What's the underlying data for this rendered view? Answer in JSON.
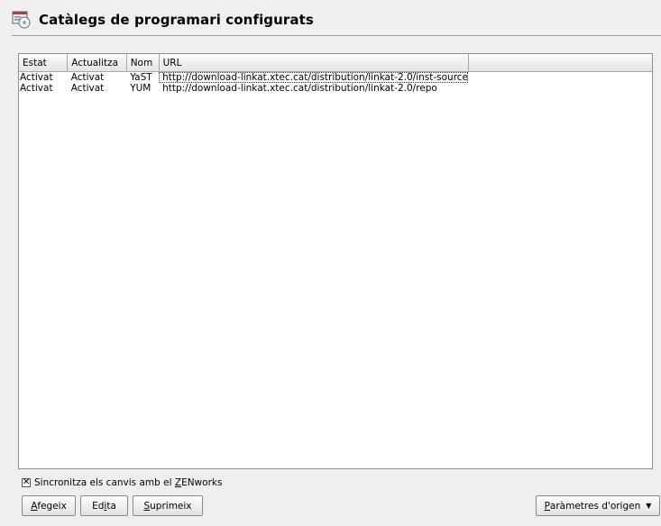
{
  "window": {
    "title": "Catàlegs de programari configurats"
  },
  "table": {
    "columns": [
      "Estat",
      "Actualitza",
      "Nom",
      "URL"
    ],
    "rows": [
      {
        "estat": "Activat",
        "actualitza": "Activat",
        "nom": "YaST",
        "url": "http://download-linkat.xtec.cat/distribution/linkat-2.0/inst-source"
      },
      {
        "estat": "Activat",
        "actualitza": "Activat",
        "nom": "YUM",
        "url": "http://download-linkat.xtec.cat/distribution/linkat-2.0/repo"
      }
    ]
  },
  "sync": {
    "checked": true,
    "label_before": "Sincronitza els canvis amb el ",
    "label_mnemonic": "Z",
    "label_after": "ENworks"
  },
  "buttons": {
    "add": {
      "mnemonic": "A",
      "rest": "fegeix"
    },
    "edit": {
      "before": "Ed",
      "mnemonic": "i",
      "after": "ta"
    },
    "delete": {
      "mnemonic": "S",
      "rest": "uprimeix"
    },
    "source_params": {
      "mnemonic": "P",
      "rest": "aràmetres d'origen"
    }
  },
  "icons": {
    "title": "catalog-window-icon",
    "checkbox": "check-mark-icon",
    "dropdown": "chevron-down-icon"
  }
}
